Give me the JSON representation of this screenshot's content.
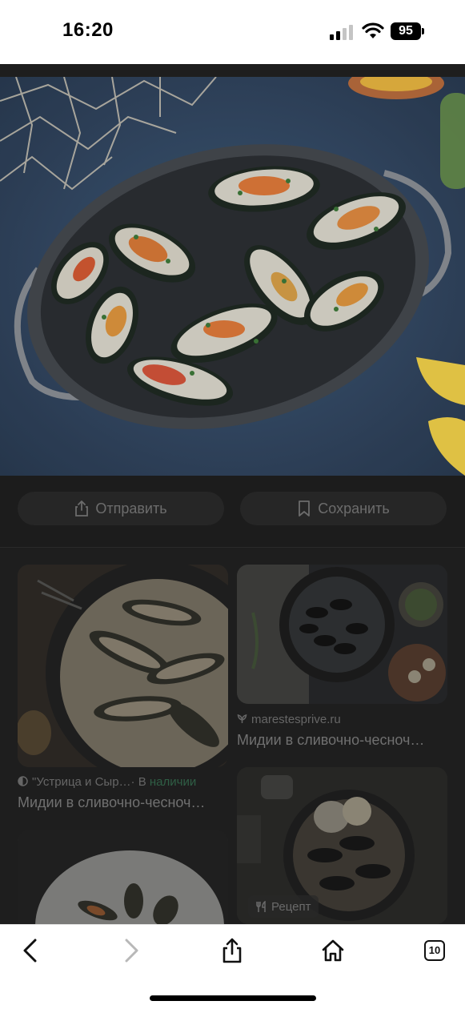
{
  "status": {
    "time": "16:20",
    "battery": "95"
  },
  "actions": {
    "share_label": "Отправить",
    "save_label": "Сохранить"
  },
  "results": [
    {
      "source": "\"Устрица и Сыр…",
      "availability_prefix": "· В ",
      "availability": "наличии",
      "title": "Мидии в сливочно-чесноч…"
    },
    {
      "source": "marestesprive.ru",
      "title": "Мидии в сливочно-чесноч…"
    },
    {
      "badge": "Рецепт"
    }
  ],
  "toolbar": {
    "tab_count": "10"
  },
  "icons": [
    "signal-icon",
    "wifi-icon",
    "share-icon",
    "bookmark-icon",
    "back-icon",
    "forward-icon",
    "home-icon",
    "tabs-icon",
    "cutlery-icon"
  ]
}
